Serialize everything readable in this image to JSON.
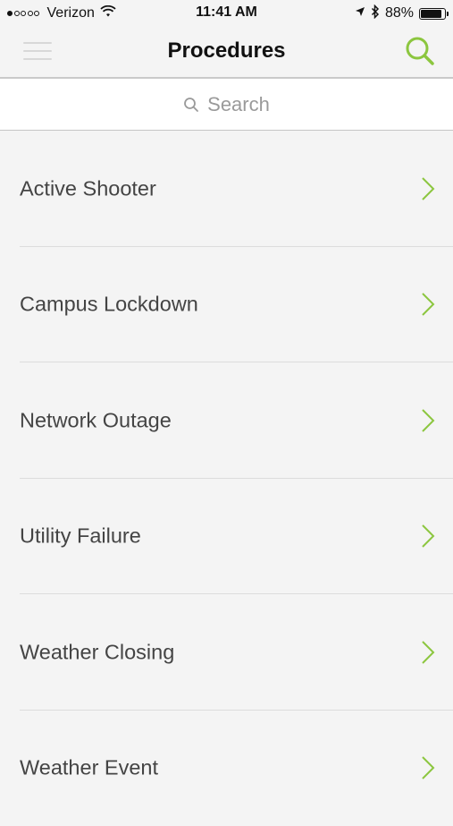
{
  "status_bar": {
    "carrier": "Verizon",
    "time": "11:41 AM",
    "battery": "88%",
    "battery_level": 0.88,
    "signal_dots_filled": 1,
    "signal_dots_total": 5
  },
  "nav": {
    "title": "Procedures",
    "menu_icon": "hamburger-menu-icon",
    "search_icon": "search-icon"
  },
  "search": {
    "placeholder": "Search"
  },
  "procedures": [
    {
      "label": "Active Shooter"
    },
    {
      "label": "Campus Lockdown"
    },
    {
      "label": "Network Outage"
    },
    {
      "label": "Utility Failure"
    },
    {
      "label": "Weather Closing"
    },
    {
      "label": "Weather Event"
    }
  ],
  "colors": {
    "accent_green": "#8cc63f",
    "background": "#f4f4f4",
    "text": "#444444"
  }
}
